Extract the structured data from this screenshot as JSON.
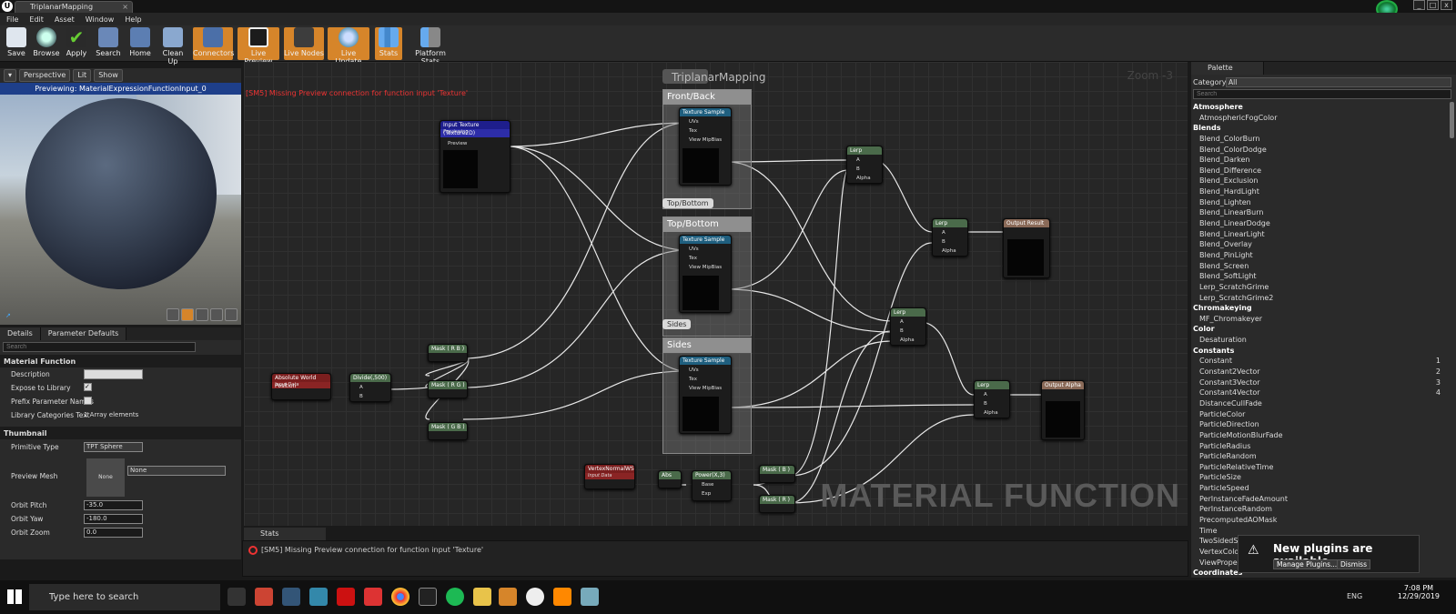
{
  "window": {
    "tab_title": "TriplanarMapping",
    "app_logo": "U",
    "controls": [
      "_",
      "□",
      "x"
    ]
  },
  "menu": [
    "File",
    "Edit",
    "Asset",
    "Window",
    "Help"
  ],
  "toolbar": [
    {
      "label": "Save",
      "icon": "save-icon",
      "active": false
    },
    {
      "label": "Browse",
      "icon": "browse-icon",
      "active": false
    },
    {
      "label": "Apply",
      "icon": "apply-icon",
      "active": false
    },
    {
      "label": "Search",
      "icon": "search-icon",
      "active": false
    },
    {
      "label": "Home",
      "icon": "home-icon",
      "active": false
    },
    {
      "label": "Clean Up",
      "icon": "clean-up-icon",
      "active": false
    },
    {
      "label": "Connectors",
      "icon": "connectors-icon",
      "active": true
    },
    {
      "label": "Live Preview",
      "icon": "live-preview-icon",
      "active": true
    },
    {
      "label": "Live Nodes",
      "icon": "live-nodes-icon",
      "active": true
    },
    {
      "label": "Live Update",
      "icon": "live-update-icon",
      "active": true
    },
    {
      "label": "Stats",
      "icon": "stats-icon",
      "active": true
    },
    {
      "label": "Platform Stats",
      "icon": "platform-stats-icon",
      "active": false
    }
  ],
  "viewport": {
    "buttons": [
      "Perspective",
      "Lit",
      "Show"
    ],
    "status": "Previewing: MaterialExpressionFunctionInput_0"
  },
  "details": {
    "tabs": [
      "Details",
      "Parameter Defaults"
    ],
    "search_placeholder": "Search",
    "section_material_function": "Material Function",
    "description_label": "Description",
    "expose_label": "Expose to Library",
    "prefix_label": "Prefix Parameter Names",
    "library_label": "Library Categories Text",
    "library_value": "1 Array elements",
    "section_thumbnail": "Thumbnail",
    "primitive_label": "Primitive Type",
    "primitive_value": "TPT Sphere",
    "preview_mesh_label": "Preview Mesh",
    "preview_mesh_thumb": "None",
    "preview_mesh_value": "None",
    "orbit_pitch_label": "Orbit Pitch",
    "orbit_pitch": "-35.0",
    "orbit_yaw_label": "Orbit Yaw",
    "orbit_yaw": "-180.0",
    "orbit_zoom_label": "Orbit Zoom",
    "orbit_zoom": "0.0"
  },
  "graph": {
    "title": "TriplanarMapping",
    "zoom": "Zoom -3",
    "error": "[SM5] Missing Preview connection for function input 'Texture'",
    "watermark": "MATERIAL FUNCTION",
    "comments": {
      "front": "Front/Back",
      "top": "Top/Bottom",
      "sides": "Sides"
    },
    "nodes": {
      "input_texture": {
        "title": "Input Texture (Texture2D)",
        "sub": "Previewing",
        "pin": "Preview"
      },
      "texture_sample": "Texture Sample",
      "ts_pins": [
        "UVs",
        "Tex",
        "View MipBias"
      ],
      "lerp": "Lerp",
      "lerp_pins": [
        "A",
        "B",
        "Alpha"
      ],
      "output_result": "Output Result",
      "output_alpha": "Output Alpha",
      "abs_world_pos": {
        "title": "Absolute World Position",
        "sub": "Input Data"
      },
      "divide": "Divide(,500)",
      "div_pins": [
        "A",
        "B"
      ],
      "mask_rb": "Mask ( R B )",
      "mask_rg": "Mask ( R G )",
      "mask_gb": "Mask ( G B )",
      "vertex_normal": {
        "title": "VertexNormalWS",
        "sub": "Input Data"
      },
      "abs": "Abs",
      "power": "Power(X,3)",
      "power_pins": [
        "Base",
        "Exp"
      ],
      "mask_b": "Mask ( B )",
      "mask_r": "Mask ( R )"
    }
  },
  "stats": {
    "tab": "Stats",
    "message": "[SM5] Missing Preview connection for function input 'Texture'"
  },
  "palette": {
    "tab": "Palette",
    "category_label": "Category:",
    "category_value": "All",
    "search_placeholder": "Search",
    "items": [
      {
        "t": "Atmosphere",
        "cat": true
      },
      {
        "t": "AtmosphericFogColor"
      },
      {
        "t": "Blends",
        "cat": true
      },
      {
        "t": "Blend_ColorBurn"
      },
      {
        "t": "Blend_ColorDodge"
      },
      {
        "t": "Blend_Darken"
      },
      {
        "t": "Blend_Difference"
      },
      {
        "t": "Blend_Exclusion"
      },
      {
        "t": "Blend_HardLight"
      },
      {
        "t": "Blend_Lighten"
      },
      {
        "t": "Blend_LinearBurn"
      },
      {
        "t": "Blend_LinearDodge"
      },
      {
        "t": "Blend_LinearLight"
      },
      {
        "t": "Blend_Overlay"
      },
      {
        "t": "Blend_PinLight"
      },
      {
        "t": "Blend_Screen"
      },
      {
        "t": "Blend_SoftLight"
      },
      {
        "t": "Lerp_ScratchGrime"
      },
      {
        "t": "Lerp_ScratchGrime2"
      },
      {
        "t": "Chromakeying",
        "cat": true
      },
      {
        "t": "MF_Chromakeyer"
      },
      {
        "t": "Color",
        "cat": true
      },
      {
        "t": "Desaturation"
      },
      {
        "t": "Constants",
        "cat": true
      },
      {
        "t": "Constant",
        "k": "1"
      },
      {
        "t": "Constant2Vector",
        "k": "2"
      },
      {
        "t": "Constant3Vector",
        "k": "3"
      },
      {
        "t": "Constant4Vector",
        "k": "4"
      },
      {
        "t": "DistanceCullFade"
      },
      {
        "t": "ParticleColor"
      },
      {
        "t": "ParticleDirection"
      },
      {
        "t": "ParticleMotionBlurFade"
      },
      {
        "t": "ParticleRadius"
      },
      {
        "t": "ParticleRandom"
      },
      {
        "t": "ParticleRelativeTime"
      },
      {
        "t": "ParticleSize"
      },
      {
        "t": "ParticleSpeed"
      },
      {
        "t": "PerInstanceFadeAmount"
      },
      {
        "t": "PerInstanceRandom"
      },
      {
        "t": "PrecomputedAOMask"
      },
      {
        "t": "Time"
      },
      {
        "t": "TwoSidedS"
      },
      {
        "t": "VertexColo"
      },
      {
        "t": "ViewPrope"
      },
      {
        "t": "Coordinates",
        "cat": true
      }
    ]
  },
  "notification": {
    "title": "New plugins are available",
    "manage": "Manage Plugins...",
    "dismiss": "Dismiss"
  },
  "taskbar": {
    "search_placeholder": "Type here to search",
    "lang": "ENG",
    "time": "7:08 PM",
    "date": "12/29/2019"
  }
}
